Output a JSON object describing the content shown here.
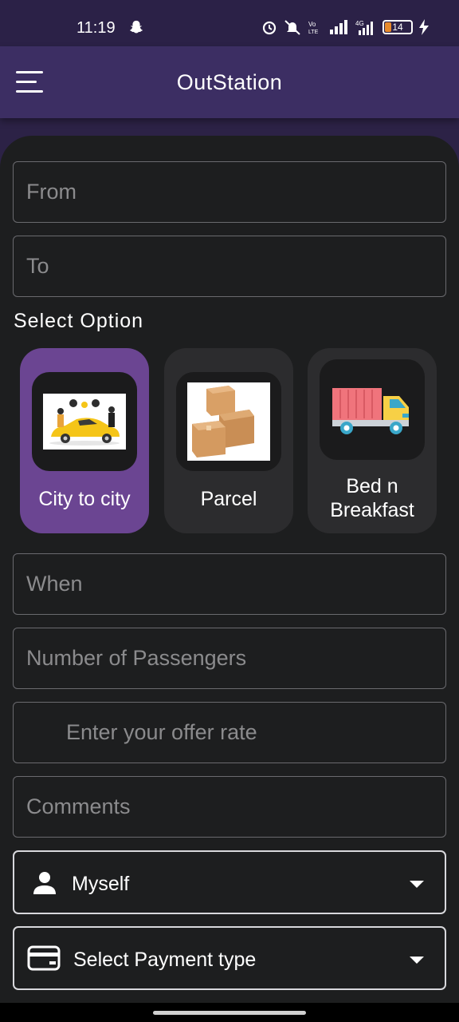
{
  "status_bar": {
    "time": "11:19",
    "battery": "14"
  },
  "app_bar": {
    "title": "OutStation"
  },
  "form": {
    "from_placeholder": "From",
    "to_placeholder": "To",
    "select_option_label": "Select Option",
    "options": [
      {
        "label": "City to city",
        "icon": "taxi-image",
        "selected": true
      },
      {
        "label": "Parcel",
        "icon": "parcel-boxes-image",
        "selected": false
      },
      {
        "label_line1": "Bed n",
        "label_line2": "Breakfast",
        "icon": "truck-icon",
        "selected": false
      }
    ],
    "when_placeholder": "When",
    "passengers_placeholder": "Number of Passengers",
    "offer_placeholder": "Enter your offer rate",
    "comments_placeholder": "Comments",
    "passenger_select": "Myself",
    "payment_select": "Select Payment type"
  },
  "colors": {
    "app_bar": "#3c2e63",
    "selected_option": "#6b4592",
    "sheet": "#1d1e1f"
  }
}
